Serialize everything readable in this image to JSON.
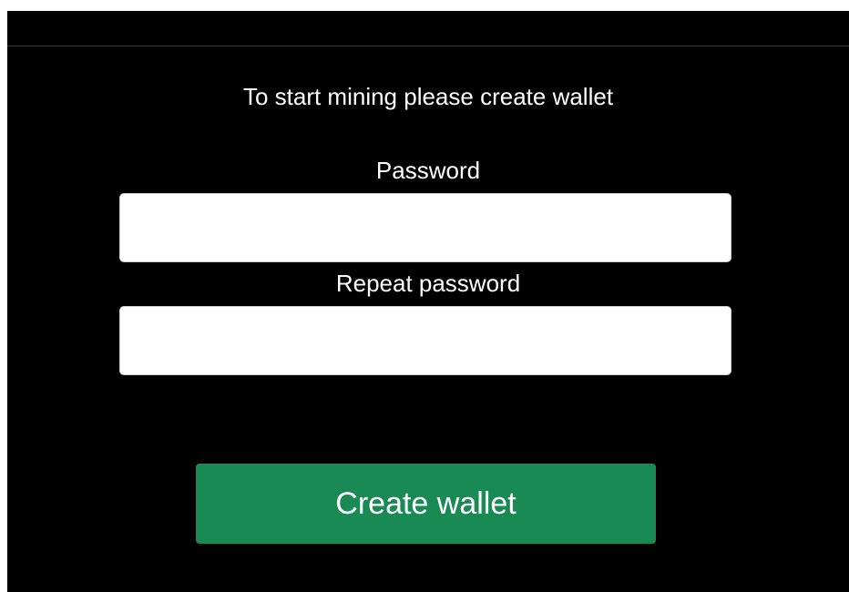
{
  "form": {
    "headline": "To start mining please create wallet",
    "password_label": "Password",
    "password_value": "",
    "repeat_label": "Repeat password",
    "repeat_value": "",
    "submit_label": "Create wallet"
  },
  "colors": {
    "background": "#000000",
    "text": "#ffffff",
    "button": "#1a8a55"
  }
}
